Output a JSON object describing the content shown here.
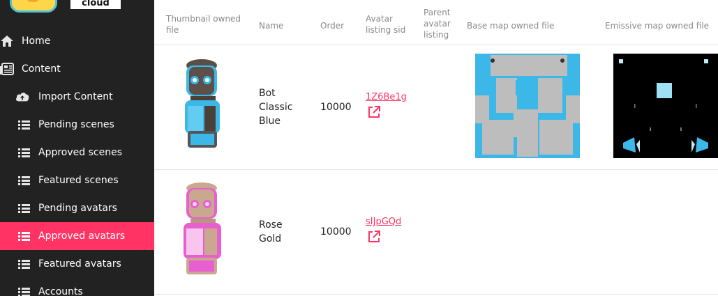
{
  "brand": {
    "logo_text": "cloud"
  },
  "sidebar": {
    "items": [
      {
        "label": "Home",
        "icon": "home-icon"
      },
      {
        "label": "Content",
        "icon": "newspaper-icon"
      },
      {
        "label": "Import Content",
        "icon": "cloud-upload-icon"
      },
      {
        "label": "Pending scenes",
        "icon": "list-icon"
      },
      {
        "label": "Approved scenes",
        "icon": "list-icon"
      },
      {
        "label": "Featured scenes",
        "icon": "list-icon"
      },
      {
        "label": "Pending avatars",
        "icon": "list-icon"
      },
      {
        "label": "Approved avatars",
        "icon": "list-icon",
        "active": true
      },
      {
        "label": "Featured avatars",
        "icon": "list-icon"
      },
      {
        "label": "Accounts",
        "icon": "list-icon"
      }
    ]
  },
  "table": {
    "headers": {
      "thumbnail": [
        "Thumbnail owned",
        "file"
      ],
      "name": "Name",
      "order": "Order",
      "sid": [
        "Avatar",
        "listing sid"
      ],
      "parent": [
        "Parent",
        "avatar",
        "listing"
      ],
      "base_map": "Base map owned file",
      "emissive_map": "Emissive map owned file"
    },
    "rows": [
      {
        "name": [
          "Bot",
          "Classic",
          "Blue"
        ],
        "order": "10000",
        "sid": "1Z6Be1g",
        "color": "#3bb7e8"
      },
      {
        "name": [
          "Rose",
          "Gold"
        ],
        "order": "10000",
        "sid": "sIJpGQd",
        "color": "#e85fd0"
      }
    ]
  },
  "colors": {
    "accent": "#ff3464",
    "sidebar": "#222222",
    "avatar_blue": "#3bb7e8",
    "avatar_pink": "#e85fd0"
  }
}
